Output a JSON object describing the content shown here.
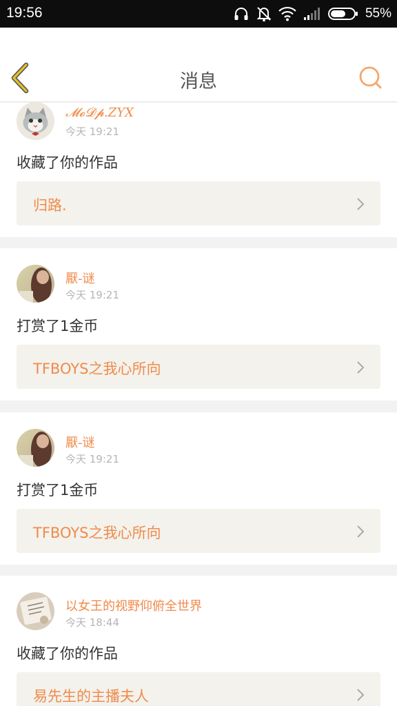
{
  "status_bar": {
    "time": "19:56",
    "battery": "55%",
    "icons": [
      "headphones-icon",
      "bell-off-icon",
      "wifi-icon",
      "signal-icon",
      "battery-icon"
    ]
  },
  "header": {
    "title": "消息",
    "back_icon": "chevron-left-icon",
    "search_icon": "search-icon"
  },
  "colors": {
    "accent": "#f08a4b",
    "back_arrow": "#e6c229",
    "text": "#333333",
    "muted": "#b5b5b5",
    "link_bg": "#f3f2ec"
  },
  "messages": [
    {
      "user": "𝓜𝓸𝓓𝓹.ZYX",
      "time": "今天 19:21",
      "action": "收藏了你的作品",
      "work": "归路."
    },
    {
      "user": "厭-谜",
      "time": "今天 19:21",
      "action": "打赏了1金币",
      "work": "TFBOYS之我心所向"
    },
    {
      "user": "厭-谜",
      "time": "今天 19:21",
      "action": "打赏了1金币",
      "work": "TFBOYS之我心所向"
    },
    {
      "user": "以女王的视野仰俯全世界",
      "time": "今天 18:44",
      "action": "收藏了你的作品",
      "work": "易先生的主播夫人"
    }
  ]
}
